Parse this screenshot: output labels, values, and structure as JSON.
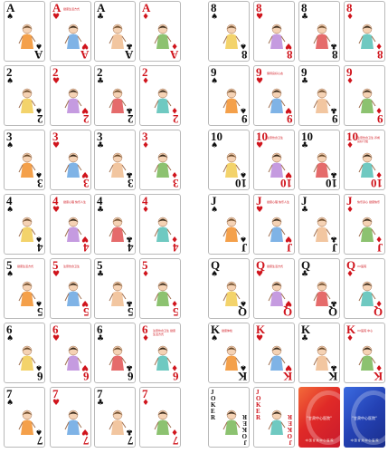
{
  "colors": {
    "red": "#d0141c",
    "black": "#111111"
  },
  "ranks": [
    "A",
    "2",
    "3",
    "4",
    "5",
    "6",
    "7",
    "8",
    "9",
    "10",
    "J",
    "Q",
    "K"
  ],
  "suits": {
    "spade": "♠",
    "heart": "♥",
    "club": "♣",
    "diamond": "♦"
  },
  "joker_label": "JOKER",
  "backs": [
    {
      "title": "\"甘肃中心医院\"",
      "subtitle": "中 国 甘 肃 中 心 医 院"
    },
    {
      "title": "\"甘肃中心医院\"",
      "subtitle": "中 国 甘 肃 中 心 医 院"
    }
  ],
  "card_texts": {
    "a_heart": "健康生活方式",
    "k_spade_red": "健康体检",
    "k_diamond": "XX医院 中心",
    "q_heart": "健康生活方式",
    "q_diamond": "XX医院",
    "j_heart": "健康心理 快乐人生",
    "j_diamond": "快乐身心 健康快乐",
    "x10_diamond": "注意饮食卫生 养成良好习惯",
    "x10_heart": "注意饮食卫生",
    "x9_heart": "保持良好心态",
    "x5_spade": "健康生活方式",
    "x5_heart": "注意饮食卫生",
    "x6_diamond": "注意饮食卫生 健康生活方式",
    "x4_heart": "健康心理 快乐人生"
  }
}
